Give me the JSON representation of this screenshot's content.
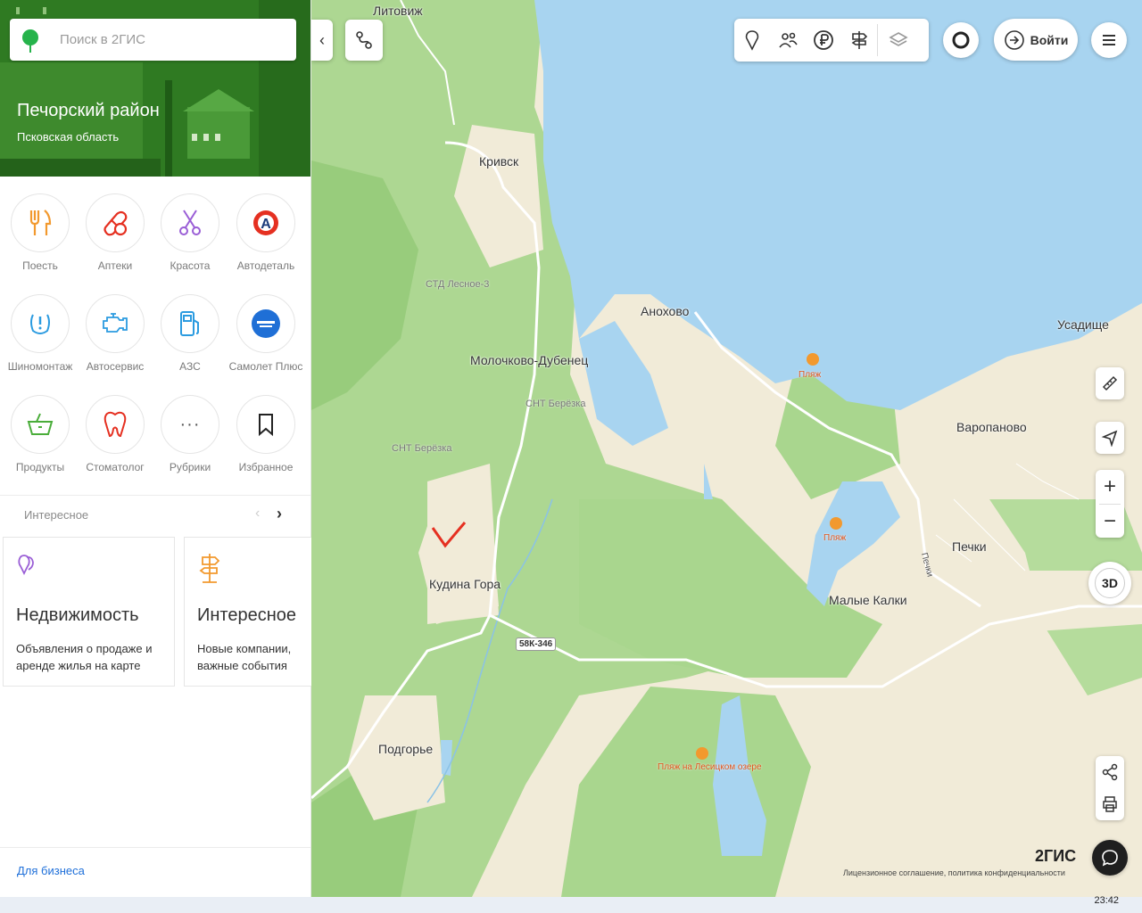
{
  "search": {
    "placeholder": "Поиск в 2ГИС"
  },
  "region": {
    "title": "Печорский район",
    "subtitle": "Псковская область"
  },
  "categories": [
    {
      "label": "Поесть",
      "icon": "fork-knife-icon"
    },
    {
      "label": "Аптеки",
      "icon": "pill-icon"
    },
    {
      "label": "Красота",
      "icon": "scissors-icon"
    },
    {
      "label": "Автодеталь",
      "icon": "autodetal-logo-icon"
    },
    {
      "label": "Шиномонтаж",
      "icon": "tire-pressure-icon"
    },
    {
      "label": "Автосервис",
      "icon": "engine-icon"
    },
    {
      "label": "АЗС",
      "icon": "fuel-pump-icon"
    },
    {
      "label": "Самолет Плюс",
      "icon": "samolet-logo-icon"
    },
    {
      "label": "Продукты",
      "icon": "basket-icon"
    },
    {
      "label": "Стоматолог",
      "icon": "tooth-icon"
    },
    {
      "label": "Рубрики",
      "icon": "more-icon"
    },
    {
      "label": "Избранное",
      "icon": "bookmark-icon"
    }
  ],
  "interesting": {
    "heading": "Интересное",
    "cards": [
      {
        "title": "Недвижимость",
        "desc": "Объявления о продаже и аренде жилья на карте"
      },
      {
        "title": "Интересное",
        "desc": "Новые компании, важные события"
      }
    ]
  },
  "business_link": "Для бизнеса",
  "toolbar": {
    "login": "Войти",
    "threed": "3D"
  },
  "map_labels": {
    "litovizh": "Литовиж",
    "krivsk": "Кривск",
    "std": "СТД Лесное-3",
    "anokhovo": "Анохово",
    "molochkovo": "Молочково-Дубенец",
    "snt1": "СНТ Берёзка",
    "snt2": "СНТ Берёзка",
    "kudina": "Кудина Гора",
    "road": "58К-346",
    "podgorye": "Подгорье",
    "usadishche": "Усадище",
    "varopanovo": "Варопаново",
    "pechki": "Печки",
    "pechki_road": "Печки",
    "malye": "Малые Калки",
    "beach1": "Пляж",
    "beach2": "Пляж",
    "beach3": "Пляж на Лесицком озере"
  },
  "footer": {
    "brand": "2ГИС",
    "legal": "Лицензионное соглашение, политика конфиденциальности"
  },
  "clock": "23:42",
  "colors": {
    "brand_green": "#2f7a22",
    "water": "#a8d4f0",
    "forest": "#a9d68e",
    "open": "#f1ebd8",
    "accent_orange": "#f2992e",
    "link_blue": "#1e6fd9"
  }
}
